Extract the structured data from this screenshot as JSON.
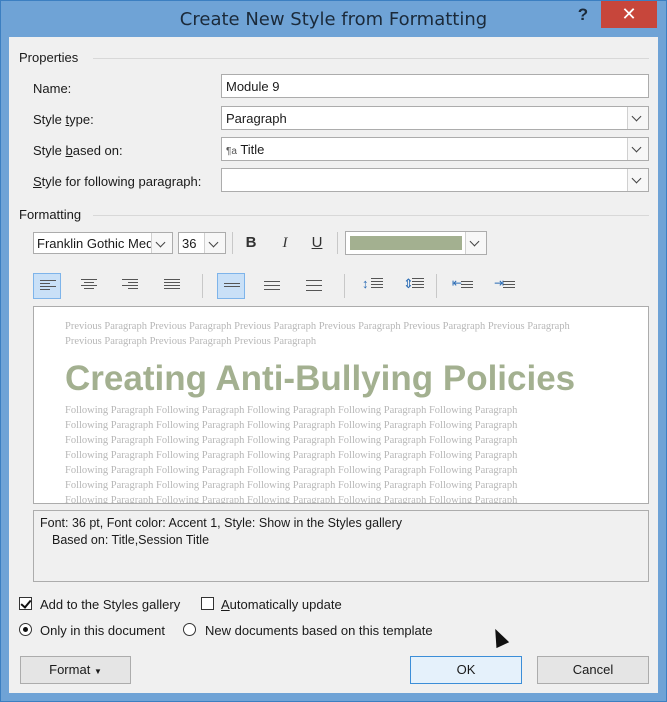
{
  "window": {
    "title": "Create New Style from Formatting",
    "help_label": "?",
    "close_label": "✕"
  },
  "properties": {
    "section_label": "Properties",
    "name": {
      "label": "Name:",
      "value": "Module 9"
    },
    "style_type": {
      "label_pre": "Style ",
      "label_u": "t",
      "label_post": "ype:",
      "value": "Paragraph"
    },
    "based_on": {
      "label_pre": "Style ",
      "label_u": "b",
      "label_post": "ased on:",
      "icon": "¶a",
      "value": "Title"
    },
    "following": {
      "label_pre": "",
      "label_u": "S",
      "label_post": "tyle for following paragraph:",
      "value": ""
    }
  },
  "formatting": {
    "section_label": "Formatting",
    "font": "Franklin Gothic Medi",
    "size": "36",
    "bold": "B",
    "italic": "I",
    "underline": "U",
    "font_color": "#a3b090"
  },
  "preview": {
    "previous_text": "Previous Paragraph Previous Paragraph Previous Paragraph Previous Paragraph Previous Paragraph Previous Paragraph Previous Paragraph Previous Paragraph Previous Paragraph",
    "sample_text": "Creating Anti-Bullying Policies",
    "following_lines": [
      "Following Paragraph Following Paragraph Following Paragraph Following Paragraph Following Paragraph",
      "Following Paragraph Following Paragraph Following Paragraph Following Paragraph Following Paragraph",
      "Following Paragraph Following Paragraph Following Paragraph Following Paragraph Following Paragraph",
      "Following Paragraph Following Paragraph Following Paragraph Following Paragraph Following Paragraph",
      "Following Paragraph Following Paragraph Following Paragraph Following Paragraph Following Paragraph",
      "Following Paragraph Following Paragraph Following Paragraph Following Paragraph Following Paragraph",
      "Following Paragraph Following Paragraph Following Paragraph Following Paragraph Following Paragraph"
    ]
  },
  "description": {
    "line1": "Font: 36 pt, Font color: Accent 1, Style: Show in the Styles gallery",
    "line2": "Based on: Title,Session Title"
  },
  "options": {
    "add_to_gallery": {
      "label": "Add to the Styles gallery",
      "checked": true
    },
    "auto_update": {
      "label_u": "A",
      "label_post": "utomatically update",
      "checked": false
    },
    "only_this_doc": {
      "label": "Only in this document",
      "selected": true
    },
    "new_docs": {
      "label": "New documents based on this template",
      "selected": false
    }
  },
  "buttons": {
    "format": "Format",
    "ok": "OK",
    "cancel": "Cancel"
  }
}
